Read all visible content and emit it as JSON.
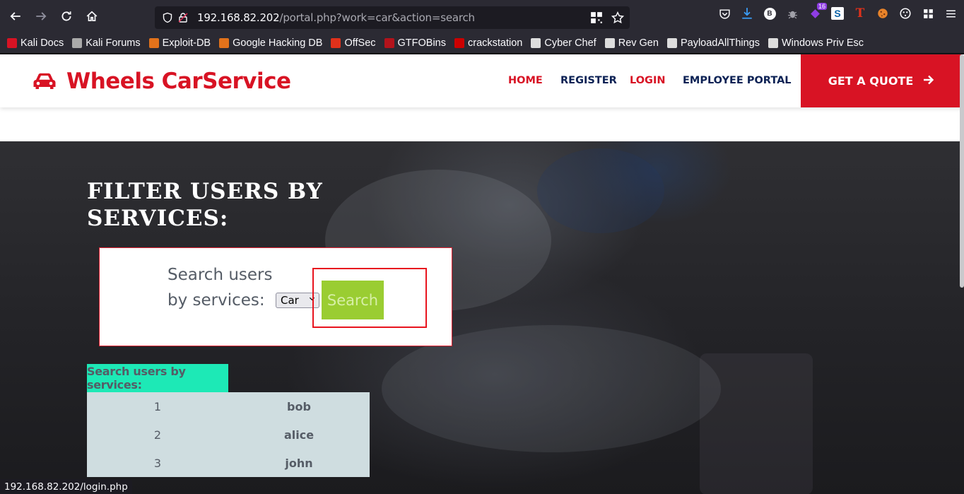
{
  "browser": {
    "url_host": "192.168.82.202",
    "url_path": "/portal.php?work=car&action=search",
    "extension_badge": "16",
    "extension_b_label": "B",
    "extension_t_label": "T",
    "bookmarks": [
      {
        "label": "Kali Docs",
        "color": "#d81324"
      },
      {
        "label": "Kali Forums",
        "color": "#aaaaaa"
      },
      {
        "label": "Exploit-DB",
        "color": "#e2721b"
      },
      {
        "label": "Google Hacking DB",
        "color": "#e2721b"
      },
      {
        "label": "OffSec",
        "color": "#e0311b"
      },
      {
        "label": "GTFOBins",
        "color": "#b3131b"
      },
      {
        "label": "crackstation",
        "color": "#cc0000"
      },
      {
        "label": "Cyber Chef",
        "color": "#dddddd"
      },
      {
        "label": "Rev Gen",
        "color": "#dddddd"
      },
      {
        "label": "PayloadAllThings",
        "color": "#dddddd"
      },
      {
        "label": "Windows Priv Esc",
        "color": "#dddddd"
      }
    ],
    "status_url": "192.168.82.202/login.php"
  },
  "site": {
    "brand": "Wheels CarService",
    "nav": {
      "home": "HOME",
      "register": "REGISTER",
      "login": "LOGIN",
      "employee": "EMPLOYEE PORTAL"
    },
    "quote_button": "GET A QUOTE",
    "accent_color": "#d81324"
  },
  "main": {
    "title": "FILTER USERS BY SERVICES:",
    "search_label": "Search users by services:",
    "selected_service": "Car",
    "search_button": "Search",
    "results_header": "Search users by services:",
    "results": [
      {
        "id": "1",
        "name": "bob"
      },
      {
        "id": "2",
        "name": "alice"
      },
      {
        "id": "3",
        "name": "john"
      }
    ]
  }
}
